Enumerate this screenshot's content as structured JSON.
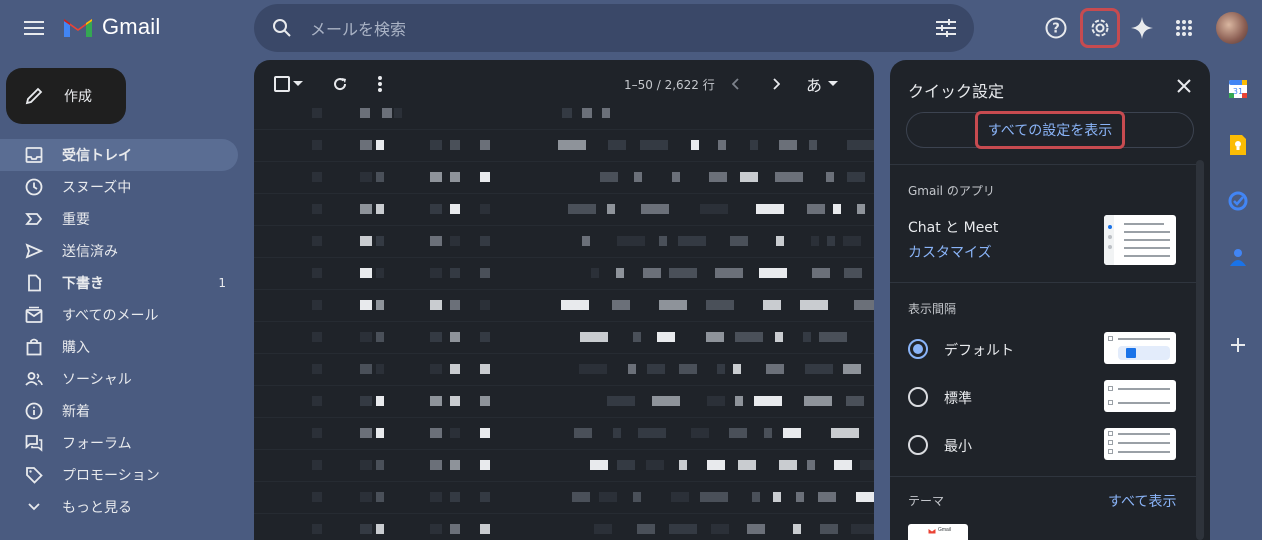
{
  "header": {
    "app_name": "Gmail",
    "search_placeholder": "メールを検索",
    "icons": [
      "menu-icon",
      "search-icon",
      "tune-icon",
      "help-icon",
      "settings-icon",
      "gemini-icon",
      "apps-icon"
    ]
  },
  "sidebar": {
    "compose_label": "作成",
    "items": [
      {
        "label": "受信トレイ",
        "icon": "inbox-icon",
        "active": true
      },
      {
        "label": "スヌーズ中",
        "icon": "clock-icon"
      },
      {
        "label": "重要",
        "icon": "important-icon"
      },
      {
        "label": "送信済み",
        "icon": "send-icon"
      },
      {
        "label": "下書き",
        "icon": "draft-icon",
        "count": "1"
      },
      {
        "label": "すべてのメール",
        "icon": "all-mail-icon"
      },
      {
        "label": "購入",
        "icon": "shopping-bag-icon"
      },
      {
        "label": "ソーシャル",
        "icon": "people-icon"
      },
      {
        "label": "新着",
        "icon": "info-icon"
      },
      {
        "label": "フォーラム",
        "icon": "forum-icon"
      },
      {
        "label": "プロモーション",
        "icon": "tag-icon"
      },
      {
        "label": "もっと見る",
        "icon": "chevron-down-icon"
      }
    ]
  },
  "mail_list": {
    "pagination": "1–50 / 2,622 行",
    "input_tool_label": "あ"
  },
  "quick_settings": {
    "title": "クイック設定",
    "all_settings_label": "すべての設定を表示",
    "apps_section": "Gmail のアプリ",
    "apps_item": "Chat と Meet",
    "customize_link": "カスタマイズ",
    "density_section": "表示間隔",
    "density_options": [
      {
        "label": "デフォルト",
        "selected": true
      },
      {
        "label": "標準",
        "selected": false
      },
      {
        "label": "最小",
        "selected": false
      }
    ],
    "theme_section": "テーマ",
    "theme_show_all": "すべて表示",
    "theme_thumb_label": "Gmail"
  },
  "colors": {
    "background": "#4a5b80",
    "panel": "#1f2329",
    "highlight_border": "#c74b50",
    "link": "#8ab4f8"
  }
}
